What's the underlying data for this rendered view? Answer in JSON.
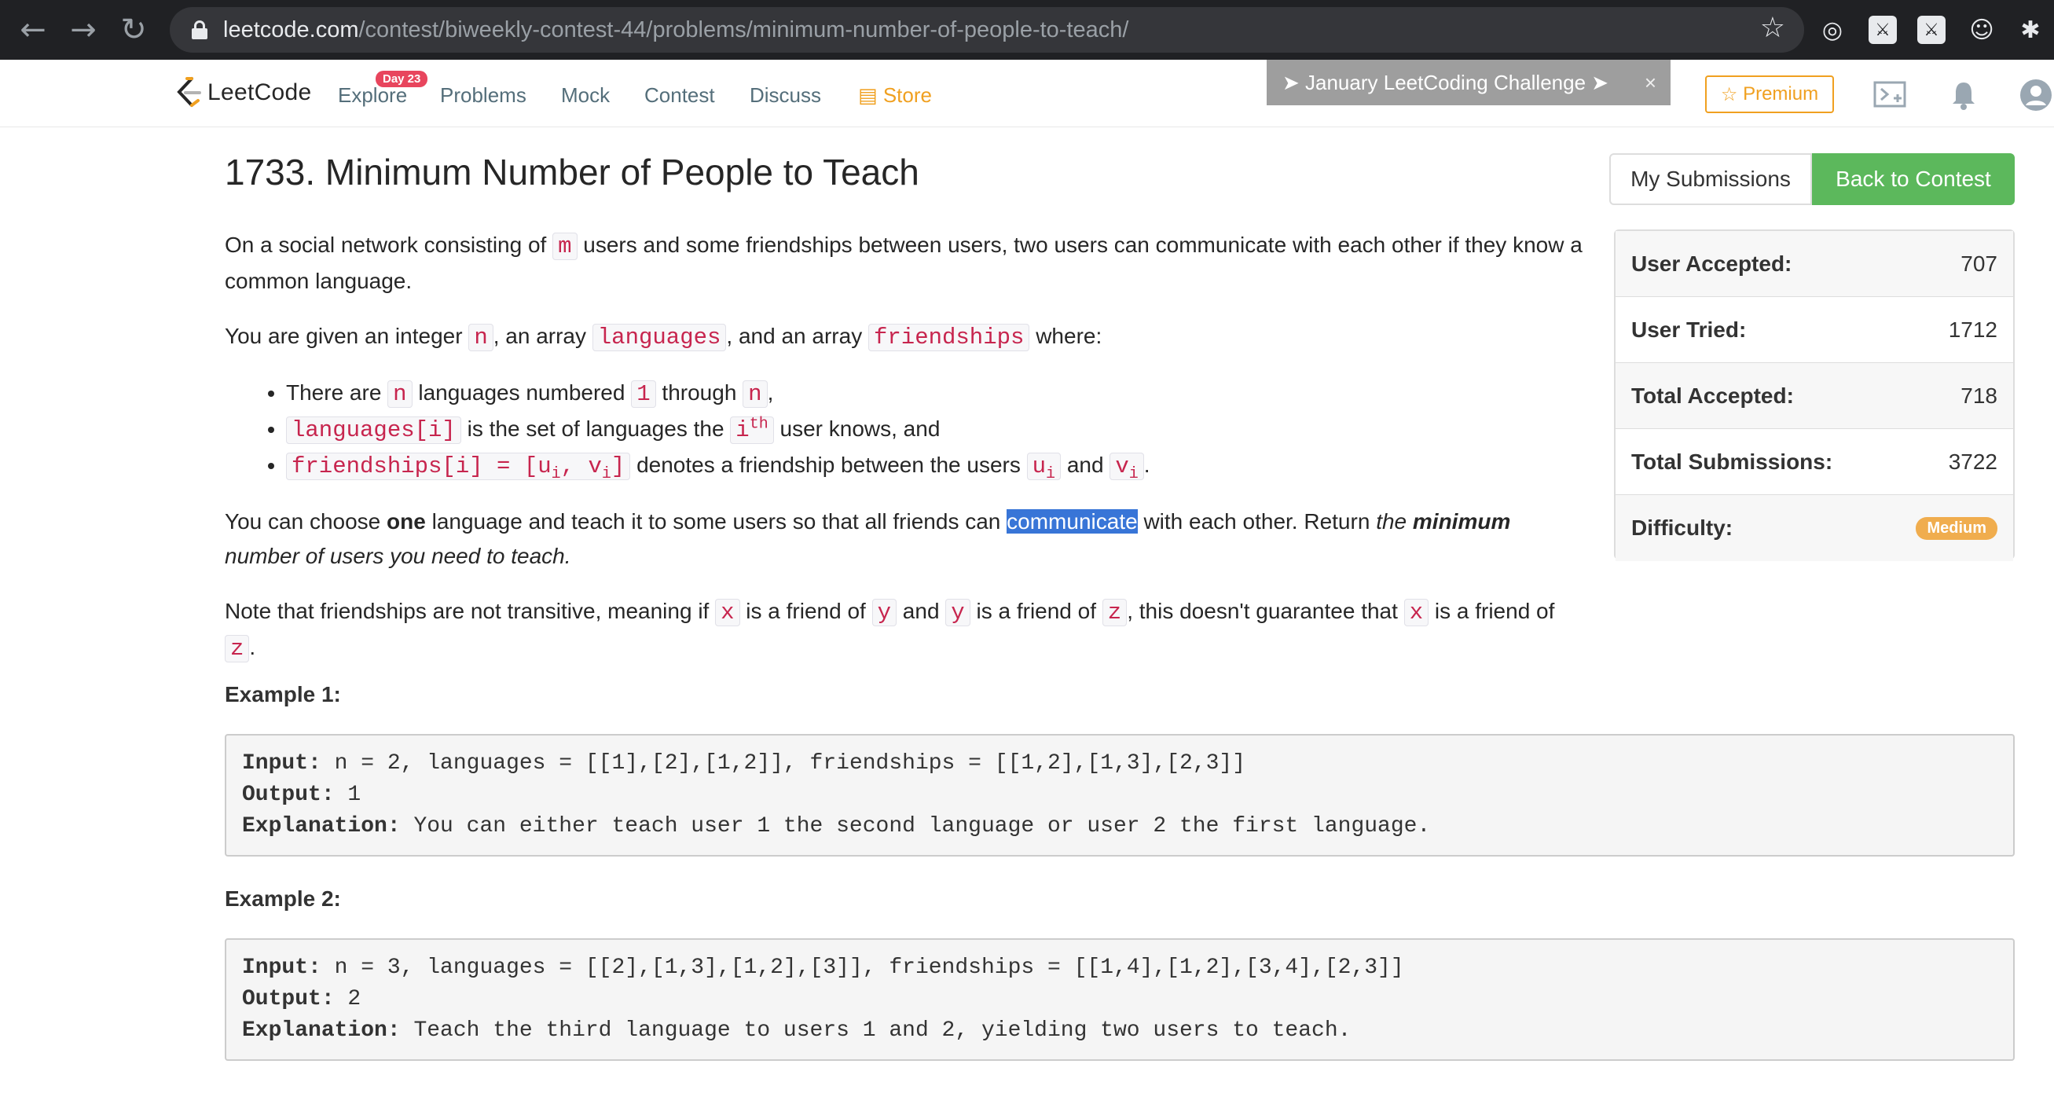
{
  "browser": {
    "url_host": "leetcode.com",
    "url_path": "/contest/biweekly-contest-44/problems/minimum-number-of-people-to-teach/"
  },
  "nav": {
    "logo_text": "LeetCode",
    "explore": "Explore",
    "explore_badge": "Day 23",
    "problems": "Problems",
    "mock": "Mock",
    "contest": "Contest",
    "discuss": "Discuss",
    "store": "Store",
    "challenge": "January LeetCoding Challenge",
    "premium": "Premium"
  },
  "problem": {
    "title": "1733. Minimum Number of People to Teach",
    "my_submissions": "My Submissions",
    "back_to_contest": "Back to Contest"
  },
  "stats": [
    {
      "label": "User Accepted:",
      "value": "707"
    },
    {
      "label": "User Tried:",
      "value": "1712"
    },
    {
      "label": "Total Accepted:",
      "value": "718"
    },
    {
      "label": "Total Submissions:",
      "value": "3722"
    }
  ],
  "difficulty": {
    "label": "Difficulty:",
    "value": "Medium"
  },
  "desc": {
    "p1_a": "On a social network consisting of ",
    "p1_m": "m",
    "p1_b": " users and some friendships between users, two users can communicate with each other if they know a common language.",
    "p2_a": "You are given an integer ",
    "p2_n": "n",
    "p2_b": ", an array ",
    "p2_languages": "languages",
    "p2_c": ", and an array ",
    "p2_friendships": "friendships",
    "p2_d": " where:",
    "li1_a": "There are ",
    "li1_n": "n",
    "li1_b": " languages numbered ",
    "li1_1": "1",
    "li1_c": " through ",
    "li1_n2": "n",
    "li1_d": ",",
    "li2_code": "languages[i]",
    "li2_a": " is the set of languages the ",
    "li2_i": "i",
    "li2_th": "th",
    "li2_b": " user knows, and",
    "li3_code_a": "friendships[i] = [u",
    "li3_sub1": "i",
    "li3_code_b": ", v",
    "li3_sub2": "i",
    "li3_code_c": "]",
    "li3_a": " denotes a friendship between the users ",
    "li3_u": "u",
    "li3_usub": "i",
    "li3_b": " and ",
    "li3_v": "v",
    "li3_vsub": "i",
    "li3_c": ".",
    "p3_a": "You can choose ",
    "p3_one": "one",
    "p3_b": " language and teach it to some users so that all friends can ",
    "p3_hl": "communicate",
    "p3_c": " with each other. Return ",
    "p3_the": "the ",
    "p3_min": "minimum",
    "p3_d": " number of users you need to teach.",
    "p4_a": "Note that friendships are not transitive, meaning if ",
    "p4_x": "x",
    "p4_b": " is a friend of ",
    "p4_y": "y",
    "p4_c": " and ",
    "p4_y2": "y",
    "p4_d": " is a friend of ",
    "p4_z": "z",
    "p4_e": ", this doesn't guarantee that ",
    "p4_x2": "x",
    "p4_f": " is a friend of ",
    "p4_z2": "z",
    "p4_g": "."
  },
  "examples": [
    {
      "title": "Example 1:",
      "input_label": "Input:",
      "input": " n = 2, languages = [[1],[2],[1,2]], friendships = [[1,2],[1,3],[2,3]]",
      "output_label": "Output:",
      "output": " 1",
      "expl_label": "Explanation:",
      "expl": " You can either teach user 1 the second language or user 2 the first language."
    },
    {
      "title": "Example 2:",
      "input_label": "Input:",
      "input": " n = 3, languages = [[2],[1,3],[1,2],[3]], friendships = [[1,4],[1,2],[3,4],[2,3]]",
      "output_label": "Output:",
      "output": " 2",
      "expl_label": "Explanation:",
      "expl": " Teach the third language to users 1 and 2, yielding two users to teach."
    }
  ],
  "colors": {
    "accent_green": "#5cb85c",
    "store_orange": "#f0a020",
    "code_red": "#c7254e",
    "badge_medium": "#f0ad4e"
  }
}
